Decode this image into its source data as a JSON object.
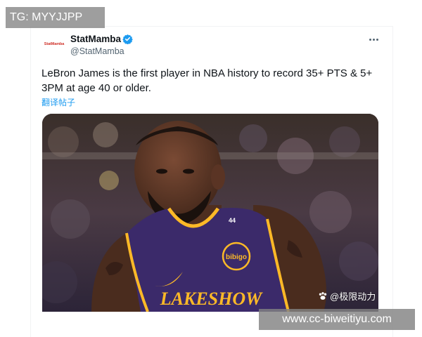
{
  "watermarks": {
    "top_left": "TG: MYYJJPP",
    "bottom_right": "www.cc-biweitiyu.com",
    "source": "@极限动力"
  },
  "tweet": {
    "avatar_text": "StatMamba",
    "display_name": "StatMamba",
    "verified": true,
    "handle": "@StatMamba",
    "text": "LeBron James is the first player in NBA history to record 35+ PTS & 5+ 3PM at age 40 or older.",
    "translate_link": "翻译帖子"
  },
  "media": {
    "jersey_text": "LAKESHOW",
    "number": "44",
    "patch_text": "bibigo"
  },
  "colors": {
    "accent": "#1d9bf0",
    "jersey": "#3b2a6a",
    "jersey_trim": "#fdb927"
  }
}
